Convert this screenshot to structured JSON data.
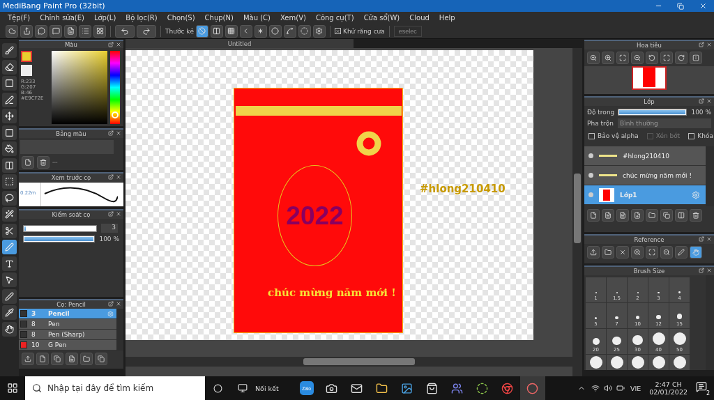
{
  "window": {
    "title": "MediBang Paint Pro (32bit)"
  },
  "menu": [
    "Tệp(F)",
    "Chỉnh sửa(E)",
    "Lớp(L)",
    "Bộ lọc(R)",
    "Chọn(S)",
    "Chụp(N)",
    "Màu (C)",
    "Xem(V)",
    "Công cụ(T)",
    "Cửa sổ(W)",
    "Cloud",
    "Help"
  ],
  "toolbar": {
    "ruler_label": "Thước kẻ",
    "rulers": [
      {
        "selected": true
      },
      {
        "selected": false
      },
      {
        "selected": false
      },
      {
        "selected": false
      },
      {
        "selected": false
      },
      {
        "selected": false
      },
      {
        "selected": false
      },
      {
        "selected": false
      },
      {
        "selected": false
      }
    ],
    "antialias": {
      "label": "Khử răng cưa",
      "checked": true
    },
    "deselect": "eselec"
  },
  "tools": [
    {
      "selected": false
    },
    {
      "selected": false
    },
    {
      "selected": false
    },
    {
      "selected": false
    },
    {
      "selected": false
    },
    {
      "selected": false
    },
    {
      "selected": false
    },
    {
      "selected": false
    },
    {
      "selected": false
    },
    {
      "selected": false
    },
    {
      "selected": false
    },
    {
      "selected": false
    },
    {
      "selected": true
    },
    {
      "selected": false
    },
    {
      "selected": false
    },
    {
      "selected": false
    },
    {
      "selected": false
    },
    {
      "selected": false
    }
  ],
  "color_panel": {
    "title": "Màu",
    "r": "R:233",
    "g": "G:207",
    "b": "B:46",
    "hex": "#E9CF2E",
    "color": "#e9cf2e"
  },
  "palette_panel": {
    "title": "Bảng màu",
    "status": "---"
  },
  "brush_preview": {
    "title": "Xem trước cọ",
    "size": "0.22m"
  },
  "brush_control": {
    "title": "Kiểm soát cọ",
    "size": {
      "level": 0.02,
      "value": "3"
    },
    "opacity": {
      "level": 1,
      "value": "100 %"
    }
  },
  "brushes": {
    "title": "Cọ: Pencil",
    "items": [
      {
        "size": "3",
        "name": "Pencil",
        "color": "#333333",
        "selected": true
      },
      {
        "size": "8",
        "name": "Pen",
        "color": "#333333",
        "selected": false
      },
      {
        "size": "8",
        "name": "Pen (Sharp)",
        "color": "#333333",
        "selected": false
      },
      {
        "size": "10",
        "name": "G Pen",
        "color": "#ee2222",
        "selected": false
      }
    ]
  },
  "document": {
    "tab": "Untitled",
    "year": "2022",
    "greeting": "chúc mừng năm mới !",
    "tag": "#hlong210410"
  },
  "navigator": {
    "title": "Hoa tiêu"
  },
  "layers": {
    "title": "Lớp",
    "opacity_label": "Độ trong",
    "opacity": {
      "level": 1,
      "value": "100 %"
    },
    "blend_label": "Pha trộn",
    "blend_value": "Bình thường",
    "options": [
      {
        "label": "Bảo vệ alpha",
        "checked": false,
        "disabled": false
      },
      {
        "label": "Xén bớt",
        "checked": false,
        "disabled": true
      },
      {
        "label": "Khóa",
        "checked": false,
        "disabled": false
      }
    ],
    "items": [
      {
        "name": "#hlong210410",
        "kind": "text",
        "selected": false
      },
      {
        "name": "chúc mừng năm mới !",
        "kind": "text",
        "selected": false
      },
      {
        "name": "Lớp1",
        "kind": "image",
        "selected": true
      }
    ]
  },
  "reference": {
    "title": "Reference"
  },
  "brush_size": {
    "title": "Brush Size",
    "sizes": [
      "1",
      "1.5",
      "2",
      "3",
      "4",
      "5",
      "7",
      "10",
      "12",
      "15",
      "20",
      "25",
      "30",
      "40",
      "50"
    ]
  },
  "taskbar": {
    "search_placeholder": "Nhập tại đây để tìm kiếm",
    "connect": "Nối kết",
    "zalo": "Zalo",
    "language": "VIE",
    "time": "2:47 CH",
    "date": "02/01/2022",
    "notifications": "2"
  }
}
